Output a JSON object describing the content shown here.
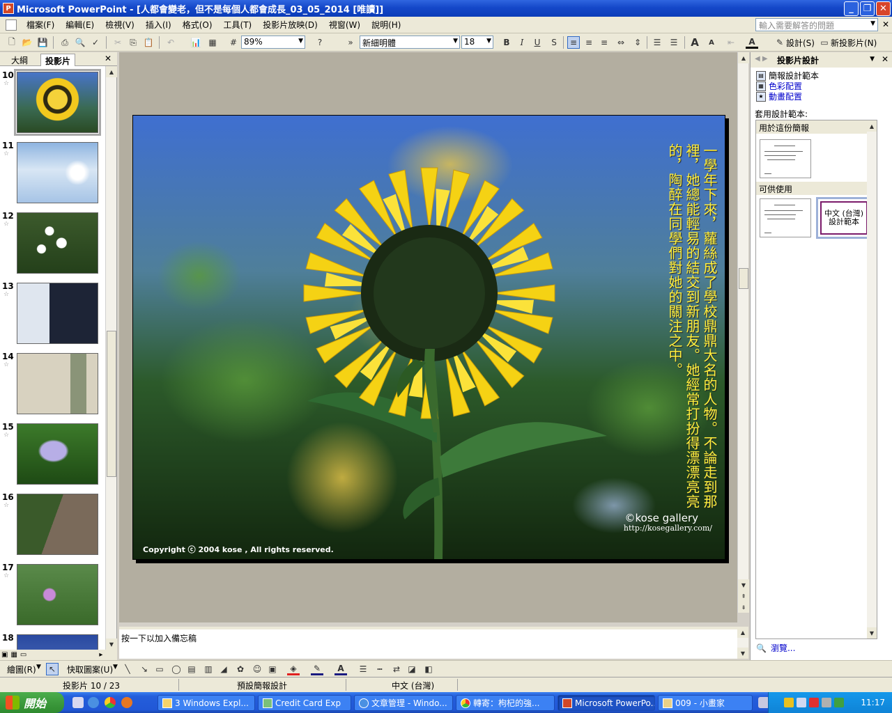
{
  "window": {
    "title": "Microsoft PowerPoint - [人都會變老，但不是每個人都會成長_03_05_2014 [唯讀]]",
    "app_icon": "powerpoint-icon"
  },
  "menu": {
    "items": [
      "檔案(F)",
      "編輯(E)",
      "檢視(V)",
      "插入(I)",
      "格式(O)",
      "工具(T)",
      "投影片放映(D)",
      "視窗(W)",
      "說明(H)"
    ],
    "help_placeholder": "輸入需要解答的問題"
  },
  "toolbar": {
    "zoom": "89%",
    "font": "新細明體",
    "font_size": "18",
    "design_label": "設計(S)",
    "new_slide_label": "新投影片(N)"
  },
  "left_pane": {
    "tabs": [
      "大綱",
      "投影片"
    ],
    "active_tab": "投影片",
    "slides": [
      {
        "num": "10",
        "selected": true
      },
      {
        "num": "11",
        "selected": false
      },
      {
        "num": "12",
        "selected": false
      },
      {
        "num": "13",
        "selected": false
      },
      {
        "num": "14",
        "selected": false
      },
      {
        "num": "15",
        "selected": false
      },
      {
        "num": "16",
        "selected": false
      },
      {
        "num": "17",
        "selected": false
      },
      {
        "num": "18",
        "selected": false
      }
    ]
  },
  "slide": {
    "text": "一學年下來，蘿絲成了學校鼎鼎大名的人物。不論走到那裡，她總能輕易的結交到新朋友。她經常打扮得漂漂亮亮的，陶醉在同學們對她的關注之中。",
    "brand": "©kose gallery",
    "url": "http://kosegallery.com/",
    "copyright": "Copyright ⓒ 2004  kose , All rights reserved.",
    "text_color": "#ffef3d"
  },
  "notes": {
    "placeholder": "按一下以加入備忘稿"
  },
  "task_pane": {
    "title": "投影片設計",
    "links": [
      "簡報設計範本",
      "色彩配置",
      "動畫配置"
    ],
    "apply_label": "套用設計範本:",
    "section_used": "用於這份簡報",
    "section_available": "可供使用",
    "chinese_template": "中文 (台灣)設計範本",
    "browse": "瀏覽..."
  },
  "drawbar": {
    "draw_label": "繪圖(R)",
    "autoshapes_label": "快取圖案(U)"
  },
  "status": {
    "slide_pos": "投影片 10 / 23",
    "design": "預設簡報設計",
    "language": "中文 (台灣)"
  },
  "taskbar": {
    "start": "開始",
    "tasks": [
      {
        "label": "3 Windows Expl...",
        "active": false
      },
      {
        "label": "Credit Card Exp",
        "active": false
      },
      {
        "label": "文章管理 - Windo...",
        "active": false
      },
      {
        "label": "轉寄：枸杞的強...",
        "active": false
      },
      {
        "label": "Microsoft PowerPo...",
        "active": true
      },
      {
        "label": "009 - 小畫家",
        "active": false
      }
    ],
    "clock": "11:17"
  }
}
